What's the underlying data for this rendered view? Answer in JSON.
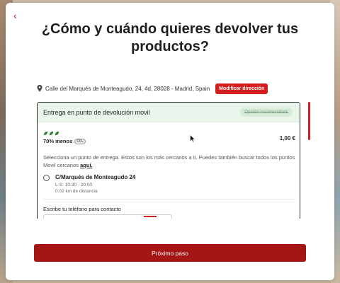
{
  "header": {
    "back_label": "‹",
    "title": "¿Cómo y cuándo quieres devolver tus productos?"
  },
  "address": {
    "text": "Calle del Marqués de Monteagudo, 24, 4d, 28028 - Madrid, Spain",
    "modify_label": "Modificar dirección"
  },
  "option": {
    "title": "Entrega en punto de devolución movil",
    "badge": "Opción recomendada",
    "eco_text": "70% menos",
    "co2_label": "CO₂",
    "price": "1,00 €",
    "help_text": "Selecciona un punto de entrega. Estos son los más cercanos a ti. Puedes también buscar todos los puntos Movil cercanos ",
    "help_link": "aquí.",
    "point": {
      "name": "C/Marqués de Monteagudo 24",
      "hours": "L-S: 10:30 - 20:00",
      "distance": "0.02 km de distancia"
    },
    "phone_label": "Escribe tu teléfono para contacto"
  },
  "footer": {
    "next_label": "Próximo paso"
  },
  "colors": {
    "accent": "#d41e1e",
    "primary_button": "#a51515",
    "recommended_bg": "#eaf6ec",
    "leaf_green": "#2e7d32"
  }
}
